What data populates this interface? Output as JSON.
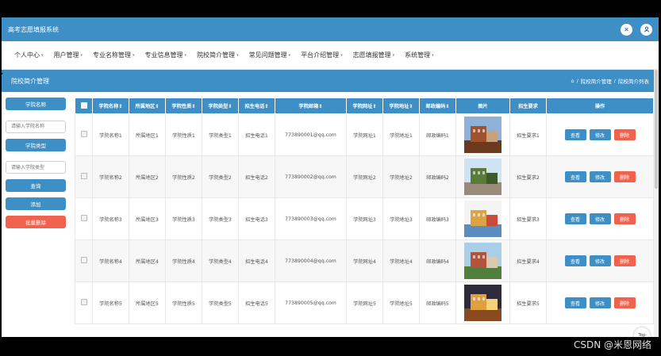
{
  "app": {
    "title": "高考志愿填报系统"
  },
  "nav": [
    {
      "label": "个人中心"
    },
    {
      "label": "用户管理"
    },
    {
      "label": "专业名称管理"
    },
    {
      "label": "专业信息管理"
    },
    {
      "label": "院校简介管理"
    },
    {
      "label": "常见问题管理"
    },
    {
      "label": "平台介绍管理"
    },
    {
      "label": "志愿填报管理"
    },
    {
      "label": "系统管理"
    }
  ],
  "band": {
    "title": "院校简介管理",
    "crumbs": [
      "院校简介管理",
      "院校简介列表"
    ],
    "sep": "/"
  },
  "sidebar": {
    "name_label": "学院名称",
    "name_placeholder": "请输入学院名称",
    "type_label": "学院类型",
    "type_placeholder": "请输入学院类型",
    "search": "查询",
    "add": "添加",
    "batch_delete": "批量删除"
  },
  "table": {
    "headers": [
      "学院名称⇕",
      "所属地区⇕",
      "学院性质⇕",
      "学院类型⇕",
      "招生电话⇕",
      "学院邮箱⇕",
      "学院网址⇕",
      "学院地址⇕",
      "邮政编码⇕",
      "图片",
      "招生要求",
      "操作"
    ],
    "rows": [
      {
        "cells": [
          "学院名称1",
          "所属地区1",
          "学院性质1",
          "学院类型1",
          "招生电话1",
          "773890001@qq.com",
          "学院网址1",
          "学院地址1",
          "邮政编码1"
        ],
        "req": "招生要求1"
      },
      {
        "cells": [
          "学院名称2",
          "所属地区2",
          "学院性质2",
          "学院类型2",
          "招生电话2",
          "773890002@qq.com",
          "学院网址2",
          "学院地址2",
          "邮政编码2"
        ],
        "req": "招生要求2"
      },
      {
        "cells": [
          "学院名称3",
          "所属地区3",
          "学院性质3",
          "学院类型3",
          "招生电话3",
          "773890003@qq.com",
          "学院网址3",
          "学院地址3",
          "邮政编码3"
        ],
        "req": "招生要求3"
      },
      {
        "cells": [
          "学院名称4",
          "所属地区4",
          "学院性质4",
          "学院类型4",
          "招生电话4",
          "773890004@qq.com",
          "学院网址4",
          "学院地址4",
          "邮政编码4"
        ],
        "req": "招生要求4"
      },
      {
        "cells": [
          "学院名称5",
          "所属地区5",
          "学院性质5",
          "学院类型5",
          "招生电话5",
          "773890005@qq.com",
          "学院网址5",
          "学院地址5",
          "邮政编码5"
        ],
        "req": "招生要求5"
      }
    ],
    "actions": {
      "view": "查看",
      "edit": "修改",
      "delete": "删除"
    }
  },
  "top_button": "Top",
  "watermark": "CSDN @米恩网络",
  "colors": {
    "primary": "#3d8fc6",
    "danger": "#f0624d"
  },
  "icons": {
    "fullscreen": "fullscreen-icon",
    "user": "user-icon",
    "home": "home-icon"
  }
}
